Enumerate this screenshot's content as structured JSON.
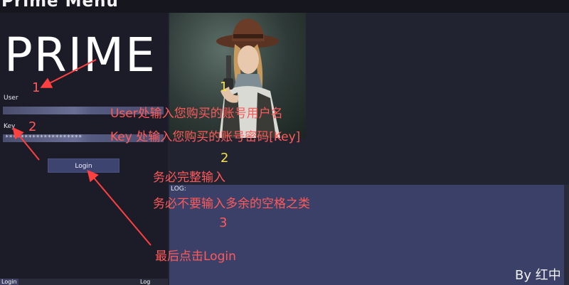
{
  "window": {
    "title": "Prime Menu"
  },
  "brand": {
    "text": "PRIME"
  },
  "form": {
    "user_label": "User",
    "user_value": "",
    "key_label": "Key",
    "key_value": "********************",
    "login_button": "Login"
  },
  "bottom_tabs": {
    "login": "Login",
    "log": "Log"
  },
  "log": {
    "label": "LOG:"
  },
  "annotations": {
    "num1_red": "1",
    "num2_red": "2",
    "num1_yellow": "1",
    "num2_yellow": "2",
    "num3_red": "3",
    "line_user": "User处输入您购买的账号用户名",
    "line_key": "Key 处输入您购买的账号密码[Key]",
    "line_complete": "务必完整输入",
    "line_no_space": "务必不要输入多余的空格之类",
    "line_click": "最后点击Login"
  },
  "credit": {
    "text": "By 红中"
  },
  "colors": {
    "annotation": "#ff5a5a",
    "yellow": "#f4e04a",
    "button": "#3e4470",
    "log_bg": "#3b4068"
  },
  "icons": {
    "photo": "cowgirl-with-revolver-image"
  }
}
